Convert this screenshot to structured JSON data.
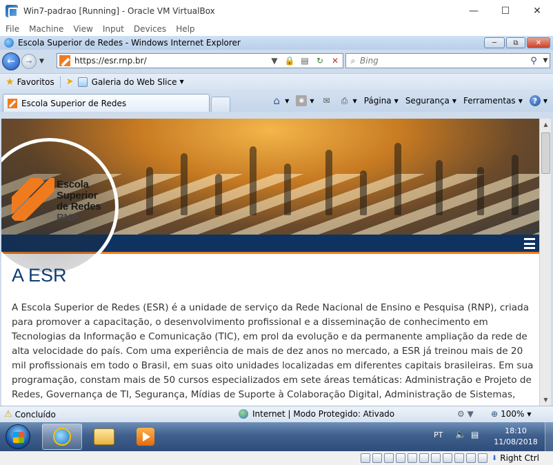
{
  "vbox": {
    "title": "Win7-padrao [Running] - Oracle VM VirtualBox",
    "menu": [
      "File",
      "Machine",
      "View",
      "Input",
      "Devices",
      "Help"
    ],
    "host_key": "Right Ctrl"
  },
  "ie": {
    "title": "Escola Superior de Redes - Windows Internet Explorer",
    "address": "https://esr.rnp.br/",
    "search_placeholder": "Bing",
    "favorites_label": "Favoritos",
    "webslice_label": "Galeria do Web Slice",
    "tab_label": "Escola Superior de Redes",
    "commands": {
      "page": "Página",
      "security": "Segurança",
      "tools": "Ferramentas"
    },
    "status": {
      "text": "Concluído",
      "zone": "Internet | Modo Protegido: Ativado",
      "zoom": "100%"
    }
  },
  "page": {
    "logo": {
      "line1": "Escola",
      "line2": "Superior",
      "line3": "de Redes",
      "line4": "RNP"
    },
    "heading": "A ESR",
    "body": "A Escola Superior de Redes (ESR) é a unidade de serviço da Rede Nacional de Ensino e Pesquisa (RNP), criada para promover a capacitação, o desenvolvimento profissional e a disseminação de conhecimento em Tecnologias da Informação e Comunicação (TIC), em prol da evolução e da permanente ampliação da rede de alta velocidade do país. Com uma experiência de mais de dez anos no mercado, a ESR já treinou mais de 20 mil profissionais em todo o Brasil, em suas oito unidades localizadas em diferentes capitais brasileiras. Em sua programação, constam mais de 50 cursos especializados em sete áreas temáticas: Administração e Projeto de Redes, Governança de TI, Segurança, Mídias de Suporte à Colaboração Digital, Administração de Sistemas,"
  },
  "taskbar": {
    "language": "PT",
    "time": "18:10",
    "date": "11/08/2018"
  },
  "colors": {
    "esr_orange": "#f07b1f",
    "esr_navy": "#0f3361",
    "heading_blue": "#0f3d73"
  }
}
